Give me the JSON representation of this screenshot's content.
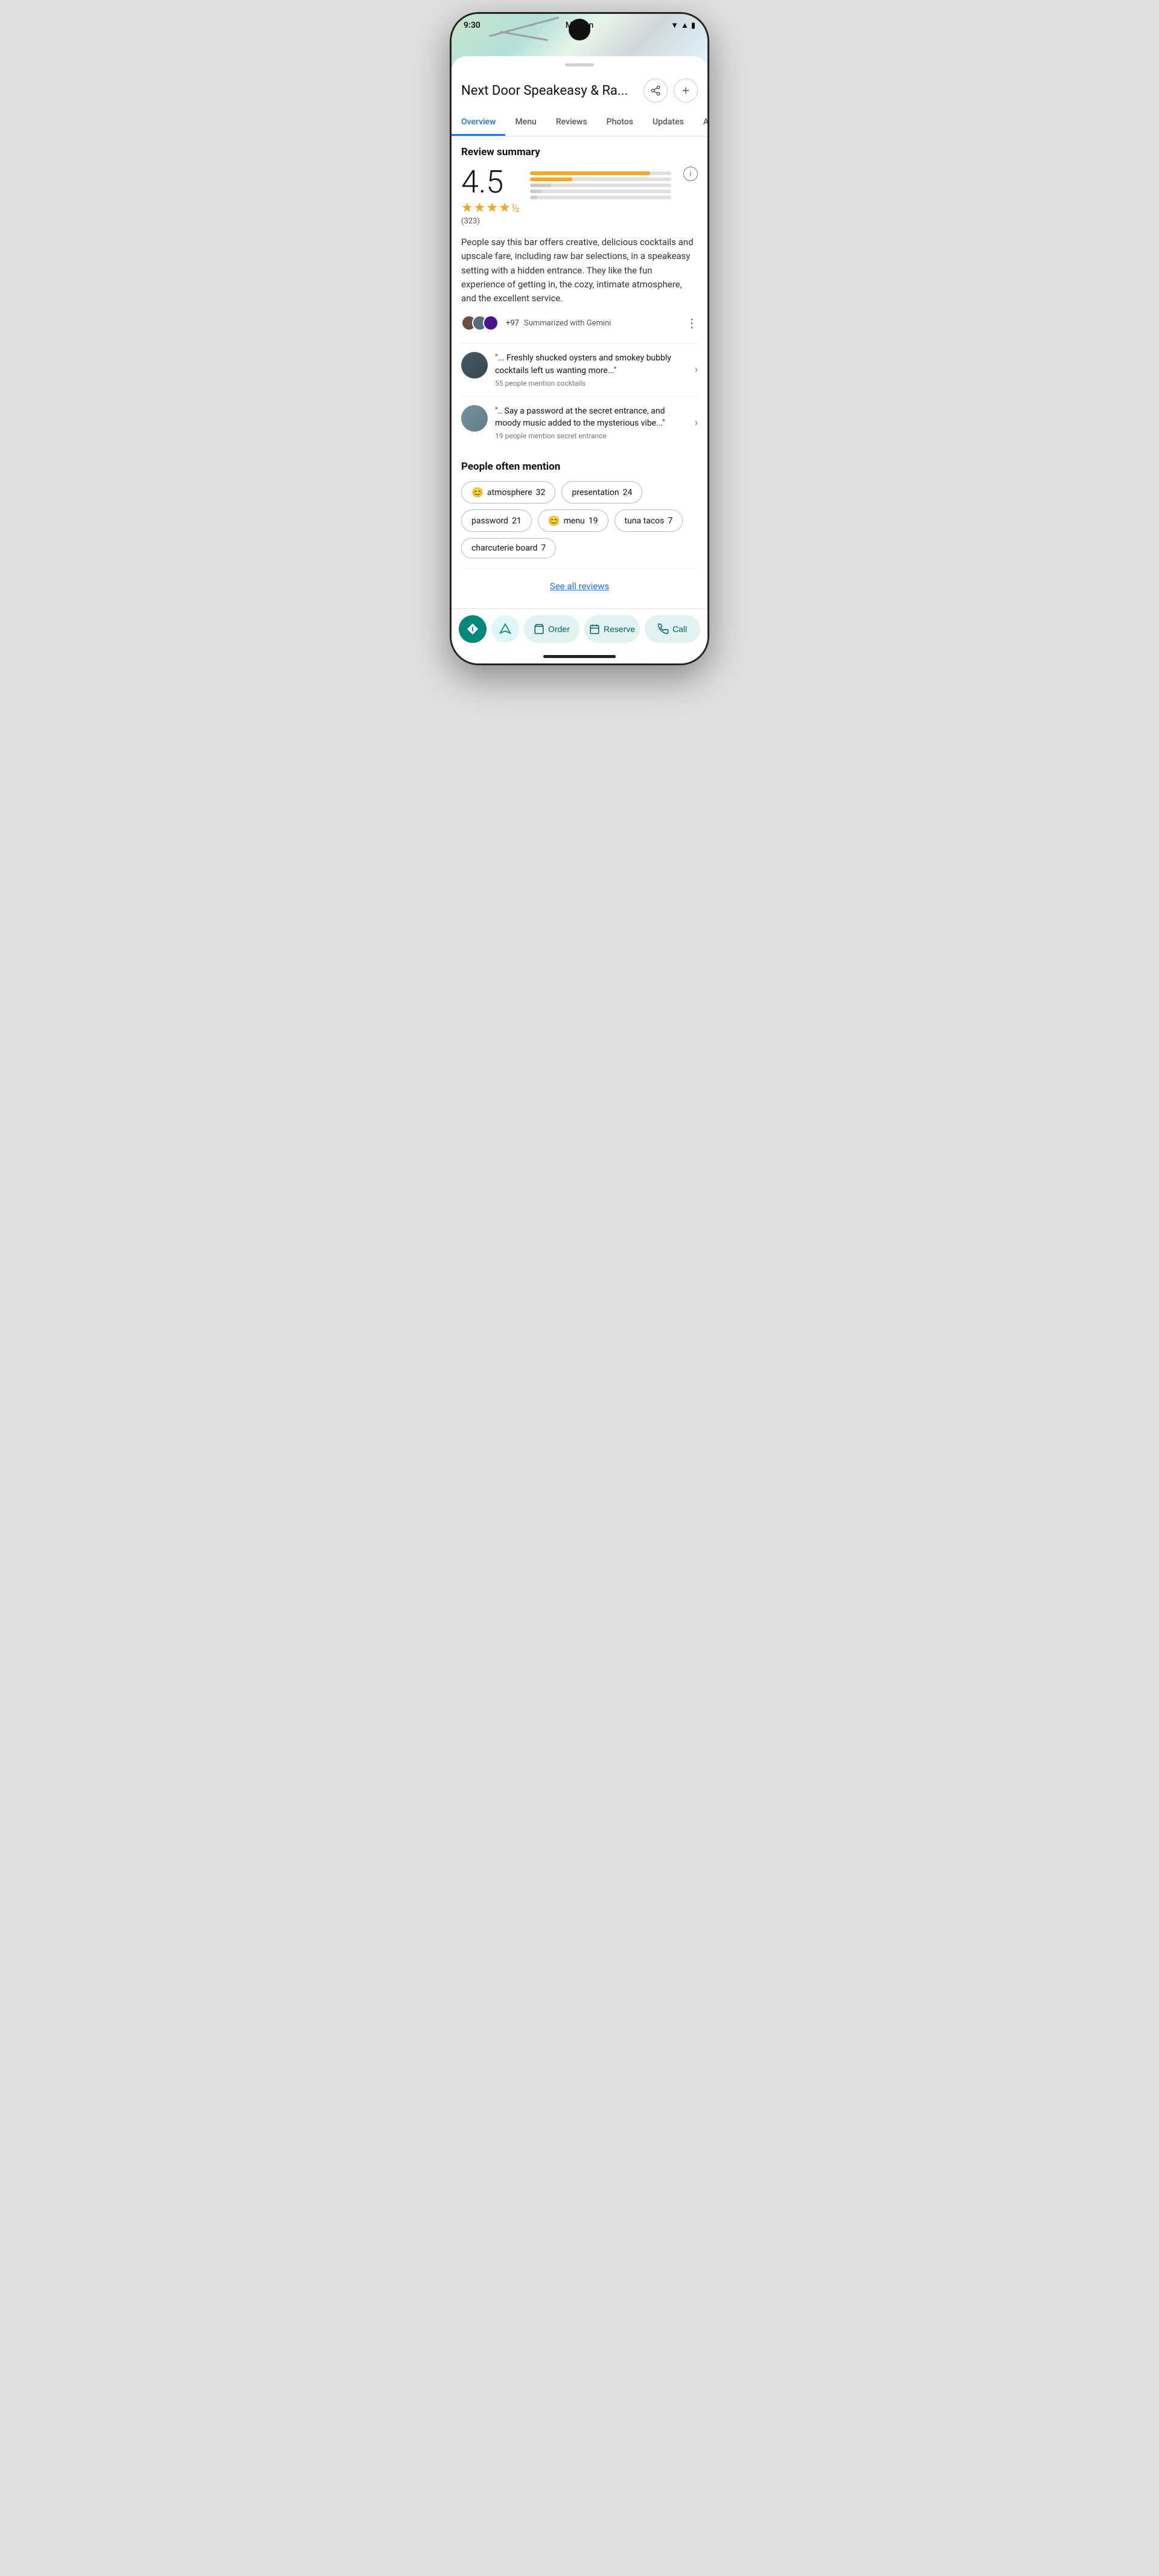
{
  "status": {
    "time": "9:30",
    "location": "Malden"
  },
  "header": {
    "title": "Next Door Speakeasy & Ra...",
    "share_label": "share",
    "add_label": "add"
  },
  "tabs": [
    {
      "id": "overview",
      "label": "Overview",
      "active": true
    },
    {
      "id": "menu",
      "label": "Menu",
      "active": false
    },
    {
      "id": "reviews",
      "label": "Reviews",
      "active": false
    },
    {
      "id": "photos",
      "label": "Photos",
      "active": false
    },
    {
      "id": "updates",
      "label": "Updates",
      "active": false
    },
    {
      "id": "about",
      "label": "About",
      "active": false
    }
  ],
  "review_summary": {
    "section_title": "Review summary",
    "rating": "4.5",
    "stars_display": "★★★★½",
    "review_count": "(323)",
    "bars": [
      {
        "pct": 85
      },
      {
        "pct": 30
      },
      {
        "pct": 15
      },
      {
        "pct": 8
      },
      {
        "pct": 5
      }
    ],
    "description": "People say this bar offers creative, delicious cocktails and upscale fare, including raw bar selections, in a speakeasy setting with a hidden entrance. They like the fun experience of getting in, the cozy, intimate atmosphere, and the excellent service.",
    "gemini_label": "Summarized with Gemini",
    "avatar_count": "+97",
    "snippets": [
      {
        "quote": "\"... Freshly shucked oysters and smokey bubbly cocktails left us wanting more...\"",
        "mention": "55 people mention cocktails"
      },
      {
        "quote": "\".. Say a password at the secret entrance, and moody music added to the mysterious vibe...\"",
        "mention": "19 people mention secret entrance"
      }
    ]
  },
  "people_mention": {
    "title": "People often mention",
    "tags": [
      {
        "label": "atmosphere",
        "count": "32",
        "emoji": "😊"
      },
      {
        "label": "presentation",
        "count": "24",
        "emoji": ""
      },
      {
        "label": "password",
        "count": "21",
        "emoji": ""
      },
      {
        "label": "menu",
        "count": "19",
        "emoji": "😊"
      },
      {
        "label": "tuna tacos",
        "count": "7",
        "emoji": ""
      },
      {
        "label": "charcuterie board",
        "count": "7",
        "emoji": ""
      }
    ]
  },
  "see_all_label": "See all reviews",
  "bottom_actions": {
    "directions_label": "directions",
    "location_label": "location",
    "order_label": "Order",
    "reserve_label": "Reserve",
    "call_label": "Call"
  }
}
